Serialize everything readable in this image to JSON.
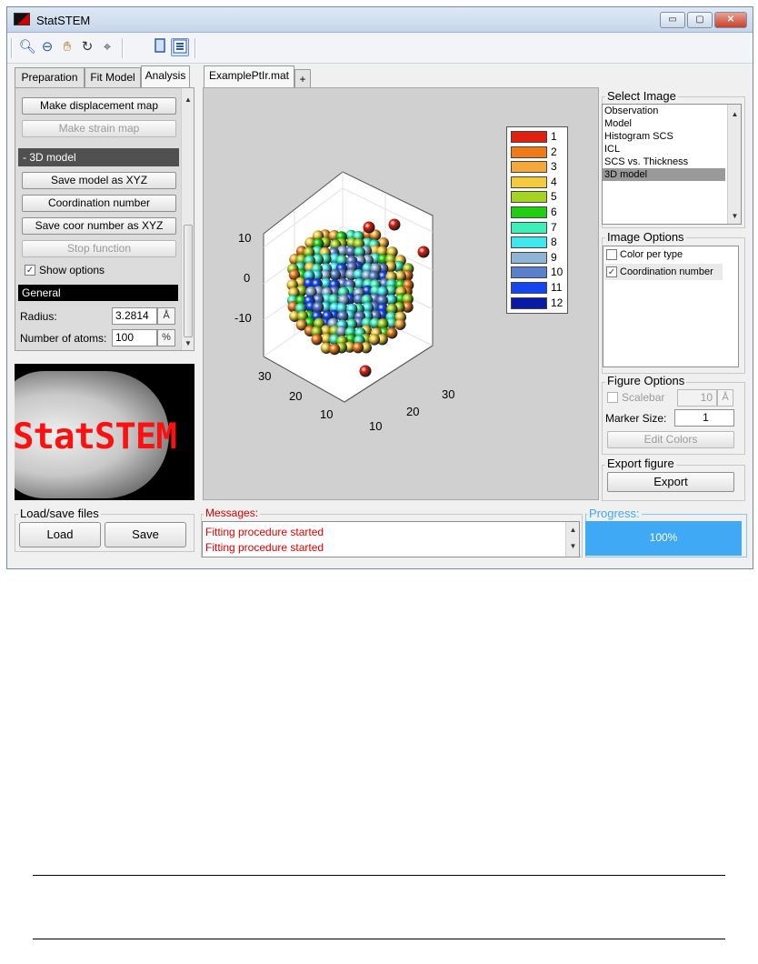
{
  "window": {
    "title": "StatSTEM",
    "controls": {
      "minimize": "▭",
      "maximize": "▢",
      "close": "✕"
    }
  },
  "toolbar": {
    "icons": [
      "zoom-in-icon",
      "zoom-out-icon",
      "pan-hand-icon",
      "rotate-3d-icon",
      "data-cursor-icon",
      "single-panel-icon",
      "panel-layout-icon"
    ]
  },
  "left": {
    "tabs": [
      "Preparation",
      "Fit Model",
      "Analysis"
    ],
    "active_tab": "Analysis",
    "buttons": {
      "displacement": "Make displacement map",
      "strain": "Make strain map",
      "save_xyz": "Save model as XYZ",
      "coordination": "Coordination number",
      "save_coor": "Save coor number as XYZ",
      "stop": "Stop function"
    },
    "section_title": "- 3D model",
    "show_options": "Show options",
    "general_header": "General",
    "radius_label": "Radius:",
    "radius_value": "3.2814",
    "radius_unit": "Å",
    "atoms_label": "Number of atoms:",
    "atoms_value": "100",
    "atoms_unit": "%",
    "logo_text": "StatSTEM",
    "load_save_title": "Load/save files",
    "load": "Load",
    "save": "Save"
  },
  "center": {
    "file_tab": "ExamplePtIr.mat",
    "add_tab": "+",
    "axis_z": [
      "10",
      "0",
      "-10"
    ],
    "axis_y": [
      "30",
      "20",
      "10"
    ],
    "axis_x": [
      "30",
      "20",
      "10"
    ],
    "legend": [
      {
        "label": "1",
        "color": "#e02010"
      },
      {
        "label": "2",
        "color": "#f07a18"
      },
      {
        "label": "3",
        "color": "#f7a83a"
      },
      {
        "label": "4",
        "color": "#f2cc3c"
      },
      {
        "label": "5",
        "color": "#a4d422"
      },
      {
        "label": "6",
        "color": "#1fcf10"
      },
      {
        "label": "7",
        "color": "#3cf0b8"
      },
      {
        "label": "8",
        "color": "#3ee8ec"
      },
      {
        "label": "9",
        "color": "#8eb4d6"
      },
      {
        "label": "10",
        "color": "#5a7fcc"
      },
      {
        "label": "11",
        "color": "#1446f0"
      },
      {
        "label": "12",
        "color": "#0a1aa6"
      }
    ]
  },
  "right": {
    "select_image_title": "Select Image",
    "images": [
      "Observation",
      "Model",
      "Histogram SCS",
      "ICL",
      "SCS vs. Thickness",
      "3D model"
    ],
    "selected_image": "3D model",
    "image_options_title": "Image Options",
    "options": [
      {
        "label": "Color per type",
        "checked": false
      },
      {
        "label": "Coordination number",
        "checked": true
      }
    ],
    "figure_options_title": "Figure Options",
    "scalebar_label": "Scalebar",
    "scalebar_value": "10",
    "scalebar_unit": "Å",
    "marker_size_label": "Marker Size:",
    "marker_size_value": "1",
    "edit_colors": "Edit Colors",
    "export_title": "Export figure",
    "export_button": "Export"
  },
  "bottom": {
    "messages_title": "Messages:",
    "messages": [
      "Fitting procedure started",
      "Fitting procedure started"
    ],
    "progress_title": "Progress:",
    "progress_text": "100%",
    "progress_value": 1.0
  },
  "colors": {
    "messages": "#e00000",
    "progress": "#3fa9f5"
  }
}
